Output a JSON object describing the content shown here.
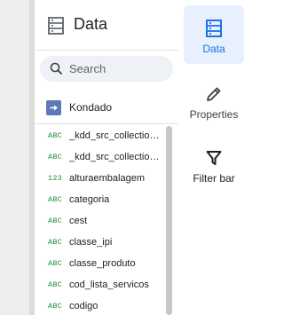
{
  "data_panel": {
    "title": "Data",
    "search": {
      "placeholder": "Search",
      "value": ""
    },
    "source": {
      "name": "Kondado"
    },
    "fields": [
      {
        "type": "ABC",
        "name": "_kdd_src_collection_name"
      },
      {
        "type": "ABC",
        "name": "_kdd_src_collection_id"
      },
      {
        "type": "123",
        "name": "alturaembalagem"
      },
      {
        "type": "ABC",
        "name": "categoria"
      },
      {
        "type": "ABC",
        "name": "cest"
      },
      {
        "type": "ABC",
        "name": "classe_ipi"
      },
      {
        "type": "ABC",
        "name": "classe_produto"
      },
      {
        "type": "ABC",
        "name": "cod_lista_servicos"
      },
      {
        "type": "ABC",
        "name": "codigo"
      }
    ]
  },
  "right_rail": {
    "tabs": [
      {
        "label": "Data",
        "icon": "data-source-icon",
        "active": true
      },
      {
        "label": "Properties",
        "icon": "pencil-icon",
        "active": false
      },
      {
        "label": "Filter bar",
        "icon": "filter-icon",
        "active": false
      }
    ]
  },
  "colors": {
    "accent": "#1a73e8",
    "text_field_type": "#1e8e3e",
    "active_tab_bg": "#e8f0fe",
    "source_icon": "#5b7bb8"
  }
}
